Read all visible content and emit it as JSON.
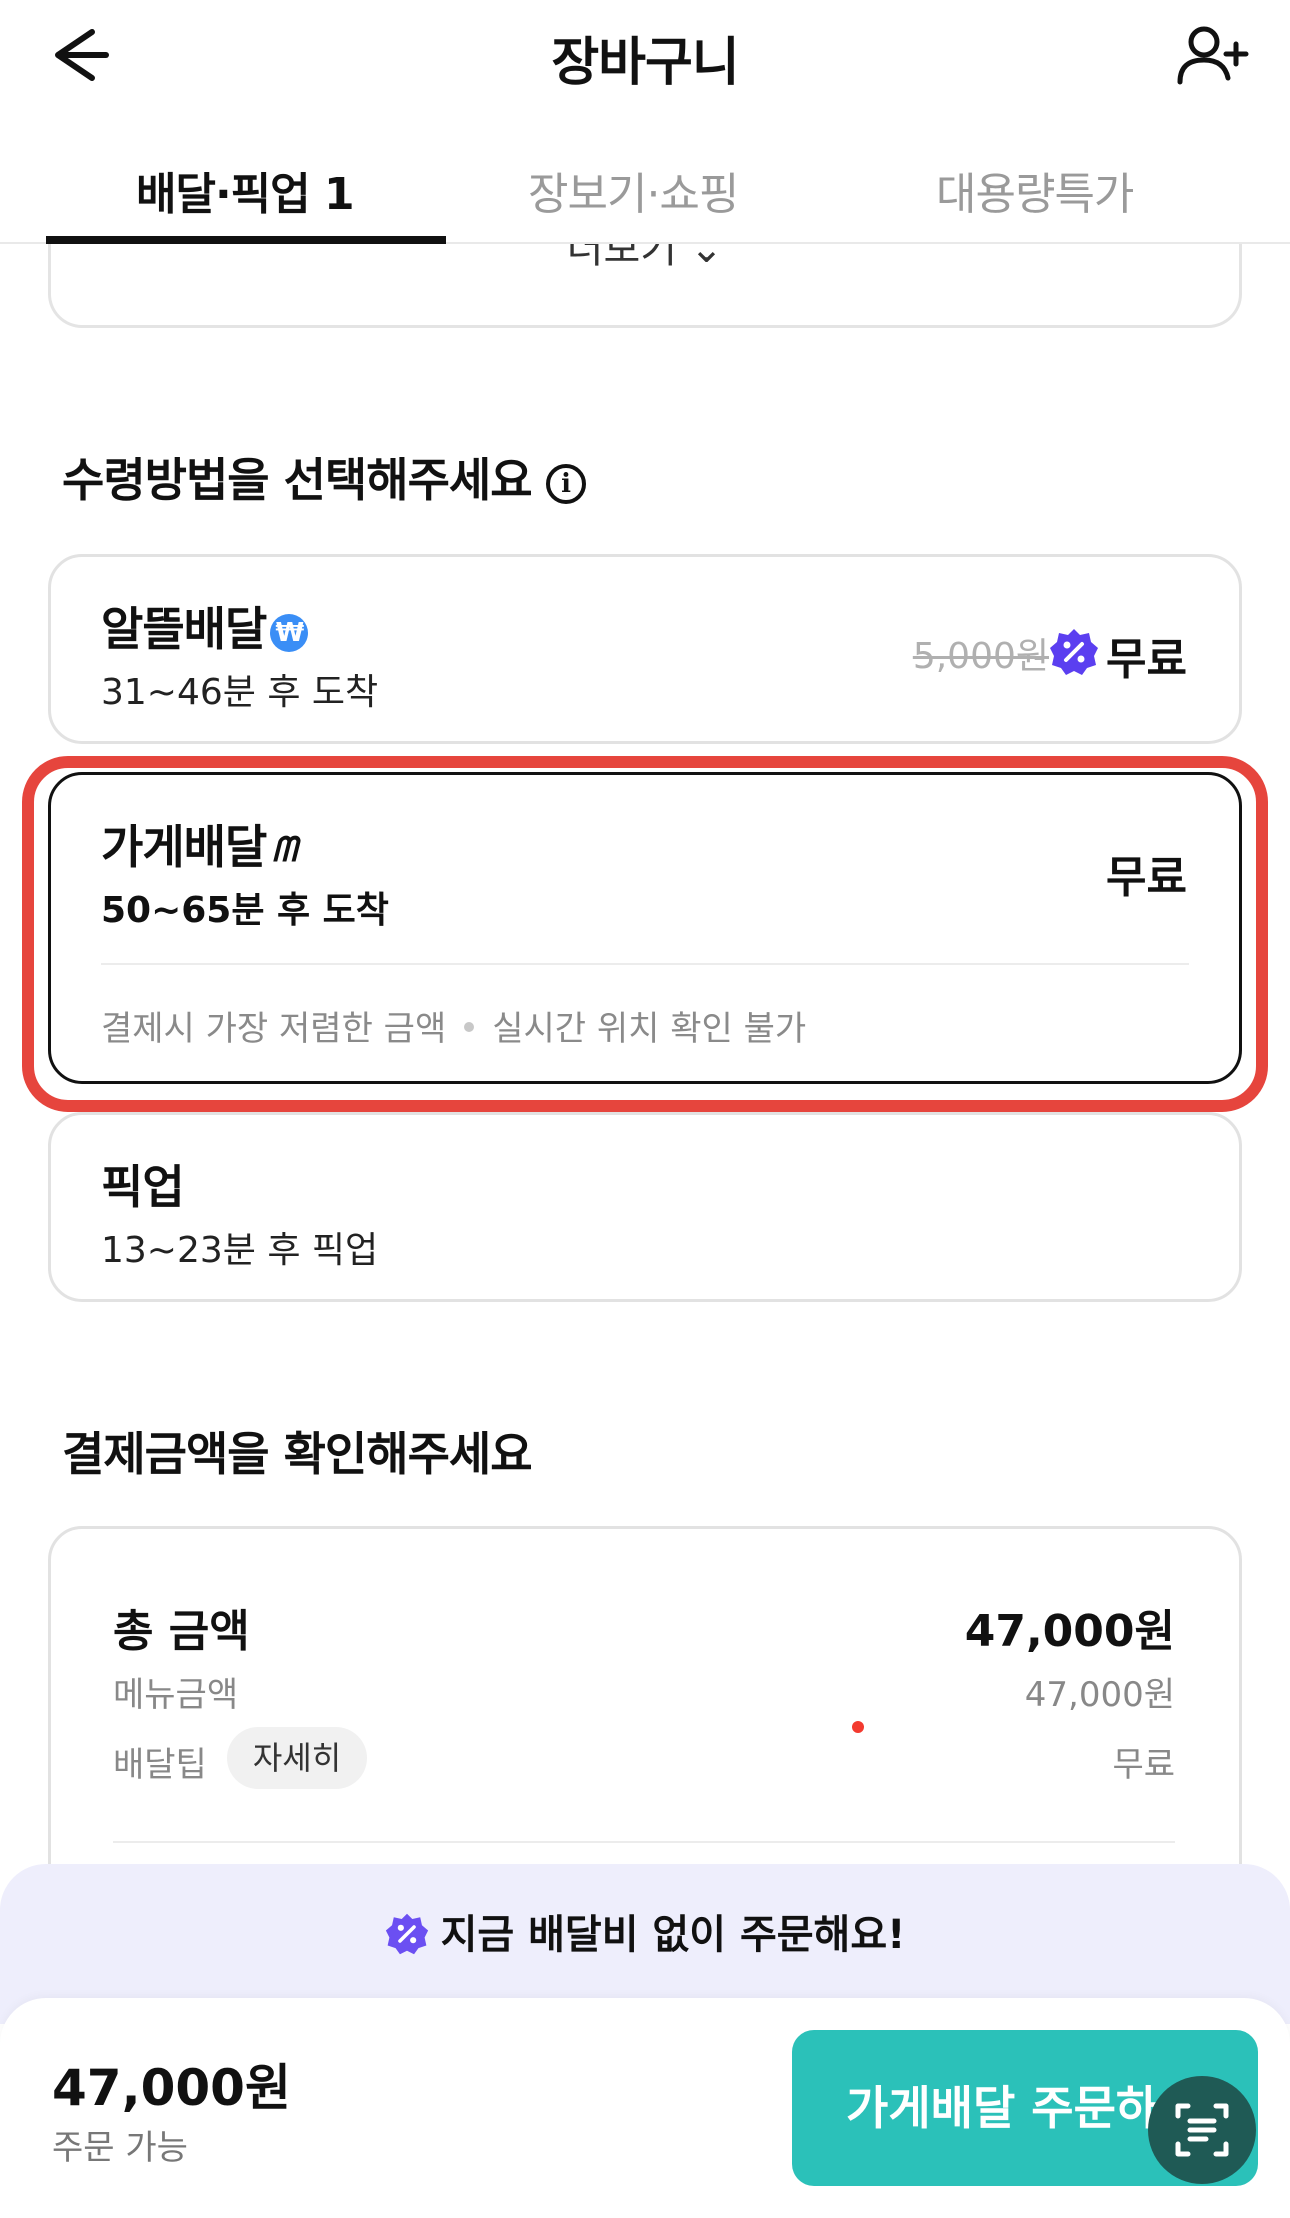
{
  "header": {
    "title": "장바구니",
    "back_icon": "arrow-left-icon",
    "add_user_icon": "person-plus-icon"
  },
  "tabs": [
    {
      "label": "배달·픽업 1",
      "active": true
    },
    {
      "label": "장보기·쇼핑",
      "active": false
    },
    {
      "label": "대용량특가",
      "active": false
    }
  ],
  "more_card": {
    "label": "더보기 ⌄"
  },
  "receive_section": {
    "title": "수령방법을 선택해주세요",
    "info_icon": "info-icon"
  },
  "options": {
    "budget": {
      "name": "알뜰배달",
      "badge": "₩",
      "time": "31~46분 후 도착",
      "old_price": "5,000원",
      "price": "무료"
    },
    "store": {
      "name": "가게배달",
      "badge": "ᗰ",
      "time": "50~65분 후 도착",
      "price": "무료",
      "note_1": "결제시 가장 저렴한 금액",
      "note_2": "실시간 위치 확인 불가"
    },
    "pickup": {
      "name": "픽업",
      "time": "13~23분 후 픽업"
    }
  },
  "payment_section": {
    "title": "결제금액을 확인해주세요",
    "total_label": "총 금액",
    "total_value": "47,000원",
    "menu_label": "메뉴금액",
    "menu_value": "47,000원",
    "tip_label": "배달팁",
    "tip_detail": "자세히",
    "tip_value": "무료"
  },
  "promo": {
    "text": "지금 배달비 없이 주문해요!"
  },
  "bottom_bar": {
    "amount": "47,000원",
    "status": "주문 가능",
    "order_label": "가게배달 주문하"
  },
  "colors": {
    "accent_teal": "#2bc1b9",
    "highlight_red": "#e6453d",
    "discount_purple": "#5b3ff0",
    "won_blue": "#3a8ef6"
  }
}
